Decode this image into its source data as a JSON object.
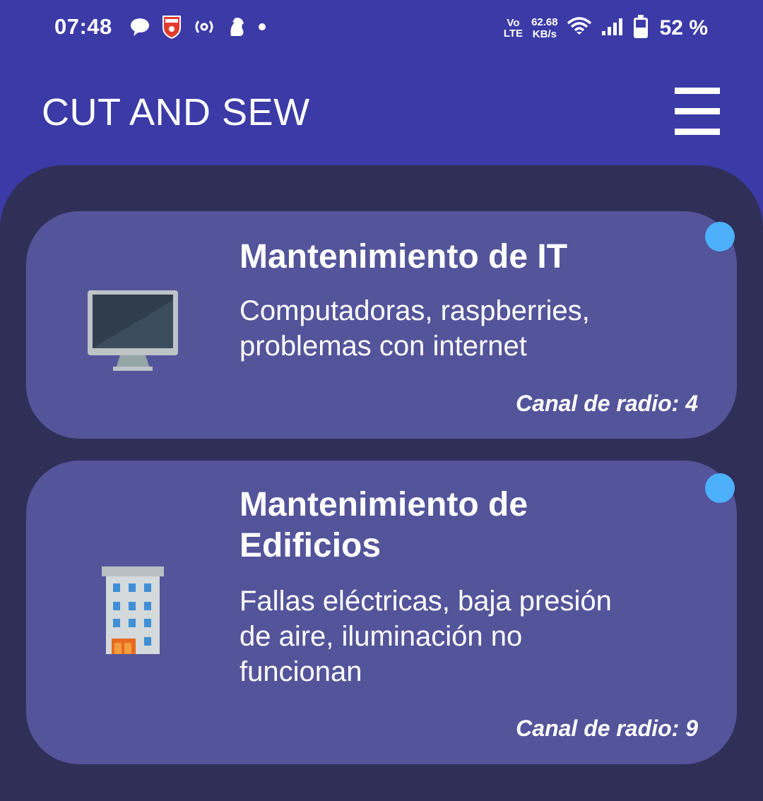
{
  "status_bar": {
    "time": "07:48",
    "volte_top": "Vo",
    "volte_bottom": "LTE",
    "speed_value": "62.68",
    "speed_unit": "KB/s",
    "battery_percent": "52 %",
    "left_icons": [
      "chat-icon",
      "arsenal-badge-icon",
      "hotspot-icon",
      "premier-league-icon",
      "notification-dot-icon"
    ],
    "right_icons": [
      "wifi-icon",
      "signal-icon",
      "battery-icon"
    ]
  },
  "app_bar": {
    "title": "CUT AND SEW",
    "menu_icon": "hamburger-menu-icon"
  },
  "cards": [
    {
      "title": "Mantenimiento de IT",
      "description_lines": [
        "Computadoras, raspberries,",
        "problemas con internet"
      ],
      "channel": "Canal de radio: 4",
      "icon": "computer-monitor-icon"
    },
    {
      "title_lines": [
        "Mantenimiento de",
        "Edificios"
      ],
      "description_lines": [
        "Fallas eléctricas, baja presión",
        "de aire, iluminación no",
        "funcionan"
      ],
      "channel": "Canal de radio: 9",
      "icon": "office-building-icon"
    }
  ],
  "colors": {
    "header_bg": "#3b3aa7",
    "panel_bg": "#302f57",
    "card_bg": "#54549b",
    "indicator_dot": "#4cb0fb",
    "text": "#ffffff"
  }
}
